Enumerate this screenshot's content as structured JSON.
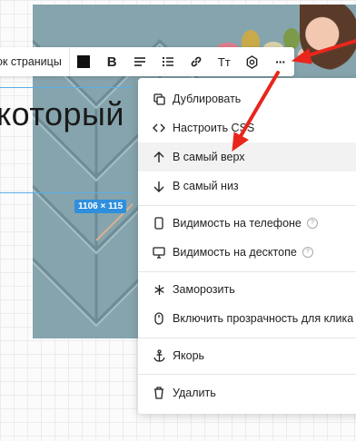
{
  "toolbar": {
    "label": "ок страницы",
    "buttons": [
      {
        "name": "color-swatch",
        "glyph": ""
      },
      {
        "name": "bold",
        "glyph": "B"
      },
      {
        "name": "align",
        "glyph": "≡"
      },
      {
        "name": "list",
        "glyph": "⁝≡"
      },
      {
        "name": "link",
        "glyph": "🔗"
      },
      {
        "name": "text-size",
        "glyph": "Tт"
      },
      {
        "name": "settings",
        "glyph": "⚙"
      },
      {
        "name": "more",
        "glyph": "···"
      }
    ]
  },
  "canvas": {
    "heading_text": "который",
    "size_badge": "1106 × 115"
  },
  "menu": {
    "items": [
      {
        "label": "Дублировать",
        "icon": "duplicate-icon"
      },
      {
        "label": "Настроить CSS",
        "icon": "code-icon"
      },
      {
        "label": "В самый верх",
        "icon": "arrow-up-icon"
      },
      {
        "label": "В самый низ",
        "icon": "arrow-down-icon"
      },
      {
        "label": "Видимость на телефоне",
        "icon": "phone-icon"
      },
      {
        "label": "Видимость на десктопе",
        "icon": "desktop-icon"
      },
      {
        "label": "Заморозить",
        "icon": "snowflake-icon"
      },
      {
        "label": "Включить прозрачность для клика",
        "icon": "mouse-icon"
      },
      {
        "label": "Якорь",
        "icon": "anchor-icon"
      },
      {
        "label": "Удалить",
        "icon": "trash-icon"
      }
    ],
    "help_glyph": "?"
  },
  "colors": {
    "accent": "#2f8fdd",
    "annotation_arrow": "#e8261c",
    "photo_bg": "#86a4ad"
  }
}
